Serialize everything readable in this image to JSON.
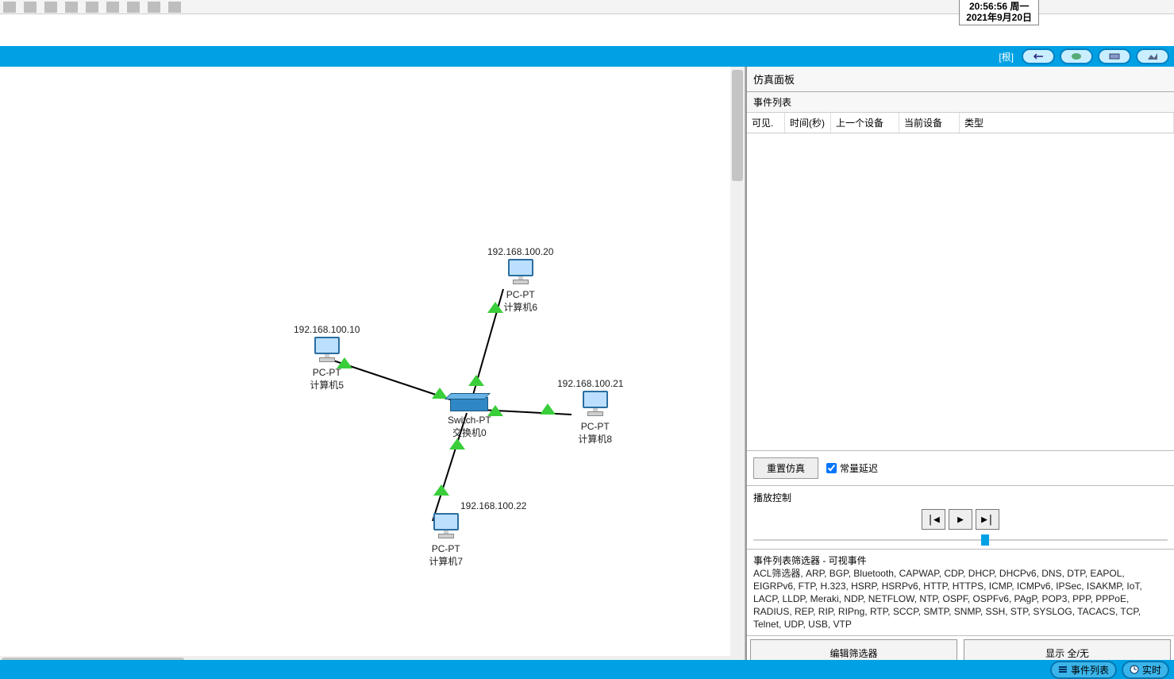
{
  "clock": {
    "time": "20:56:56 周一",
    "date": "2021年9月20日"
  },
  "blue_bar": {
    "root_label": "[根]"
  },
  "topology": {
    "switch": {
      "model": "Switch-PT",
      "name": "交换机0"
    },
    "pc5": {
      "ip": "192.168.100.10",
      "model": "PC-PT",
      "name": "计算机5"
    },
    "pc6": {
      "ip": "192.168.100.20",
      "model": "PC-PT",
      "name": "计算机6"
    },
    "pc7": {
      "ip": "192.168.100.22",
      "model": "PC-PT",
      "name": "计算机7"
    },
    "pc8": {
      "ip": "192.168.100.21",
      "model": "PC-PT",
      "name": "计算机8"
    }
  },
  "sim": {
    "panel_title": "仿真面板",
    "event_list_label": "事件列表",
    "cols": {
      "visible": "可见.",
      "time": "时间(秒)",
      "last": "上一个设备",
      "at": "当前设备",
      "type": "类型"
    },
    "reset_btn": "重置仿真",
    "const_delay": "常量延迟",
    "playback_label": "播放控制",
    "filter_title": "事件列表筛选器 - 可视事件",
    "filter_text": "ACL筛选器, ARP, BGP, Bluetooth, CAPWAP, CDP, DHCP, DHCPv6, DNS, DTP, EAPOL, EIGRPv6, FTP, H.323, HSRP, HSRPv6, HTTP, HTTPS, ICMP, ICMPv6, IPSec, ISAKMP, IoT, LACP, LLDP, Meraki, NDP, NETFLOW, NTP, OSPF, OSPFv6, PAgP, POP3, PPP, PPPoE, RADIUS, REP, RIP, RIPng, RTP, SCCP, SMTP, SNMP, SSH, STP, SYSLOG, TACACS, TCP, Telnet, UDP, USB, VTP",
    "edit_filter_btn": "编辑筛选器",
    "show_all_btn": "显示 全/无"
  },
  "bottom": {
    "event_list": "事件列表",
    "realtime": "实时"
  }
}
